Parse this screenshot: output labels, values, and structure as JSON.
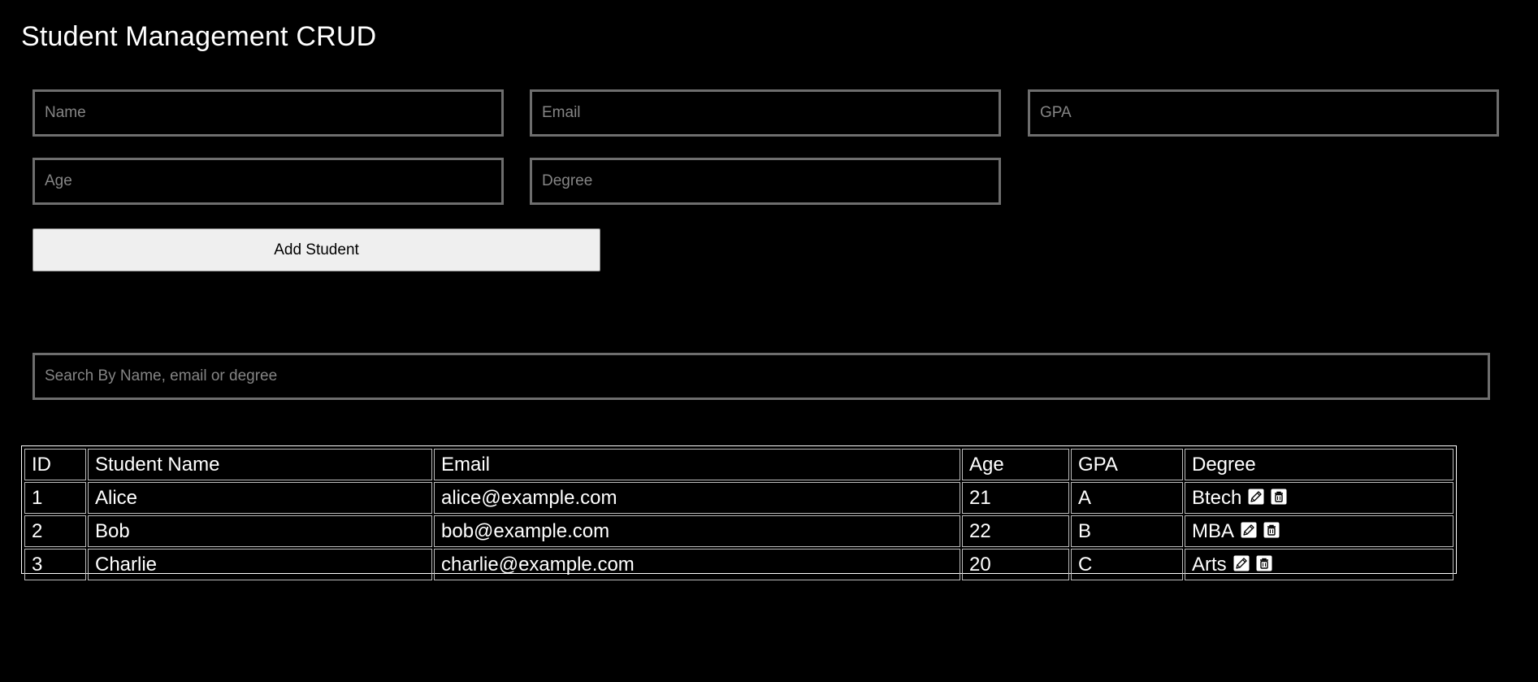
{
  "app": {
    "title": "Student Management CRUD"
  },
  "form": {
    "name_placeholder": "Name",
    "email_placeholder": "Email",
    "gpa_placeholder": "GPA",
    "age_placeholder": "Age",
    "degree_placeholder": "Degree",
    "add_button_label": "Add Student"
  },
  "search": {
    "placeholder": "Search By Name, email or degree"
  },
  "table": {
    "headers": [
      "ID",
      "Student Name",
      "Email",
      "Age",
      "GPA",
      "Degree"
    ],
    "rows": [
      {
        "id": "1",
        "name": "Alice",
        "email": "alice@example.com",
        "age": "21",
        "gpa": "A",
        "degree": "Btech"
      },
      {
        "id": "2",
        "name": "Bob",
        "email": "bob@example.com",
        "age": "22",
        "gpa": "B",
        "degree": "MBA"
      },
      {
        "id": "3",
        "name": "Charlie",
        "email": "charlie@example.com",
        "age": "20",
        "gpa": "C",
        "degree": "Arts"
      }
    ],
    "row_actions": [
      "pencil-icon",
      "trash-icon"
    ]
  },
  "colors": {
    "background": "#000000",
    "text": "#ffffff",
    "input_border": "#6e6e6e",
    "placeholder": "#858585",
    "button_bg": "#efefef"
  }
}
